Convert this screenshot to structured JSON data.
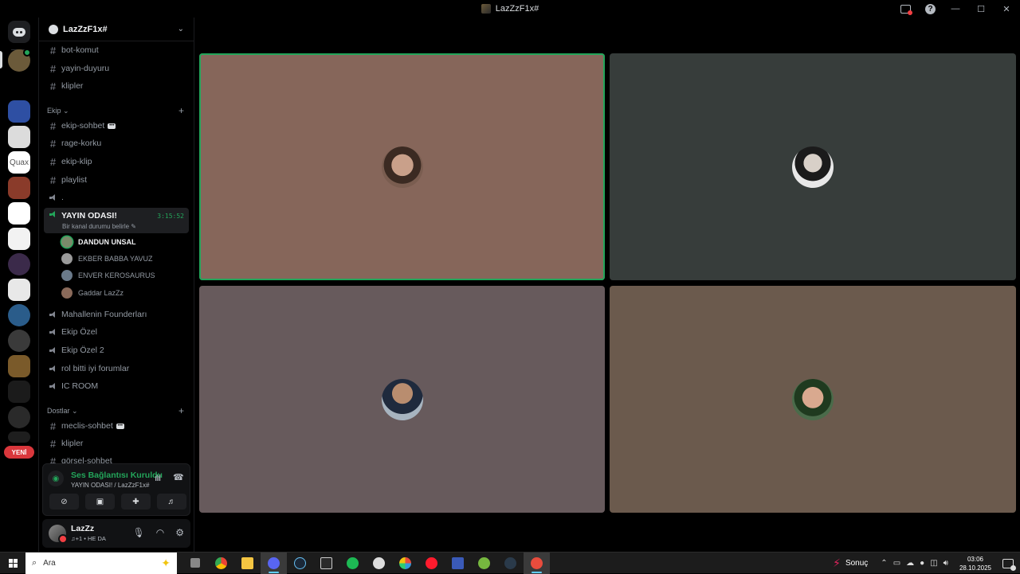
{
  "window": {
    "title": "LazZzF1x#"
  },
  "server_rail": {
    "new_badge": "YENİ",
    "servers": [
      {
        "name": "home",
        "color": "#1e1f22"
      },
      {
        "name": "server-lazzz",
        "color": "#6b5a3a"
      },
      {
        "name": "server-2",
        "color": "#2e4fa3"
      },
      {
        "name": "server-3",
        "color": "#dcdcdc"
      },
      {
        "name": "server-quax",
        "color": "#ffffff"
      },
      {
        "name": "server-5",
        "color": "#8a3b2a"
      },
      {
        "name": "server-6",
        "color": "#ffffff"
      },
      {
        "name": "server-7",
        "color": "#f2f2f2"
      },
      {
        "name": "server-8",
        "color": "#3b2a4a"
      },
      {
        "name": "server-9",
        "color": "#e8e8e8"
      },
      {
        "name": "server-10",
        "color": "#2a5c8a"
      },
      {
        "name": "server-11",
        "color": "#3a3a3a"
      },
      {
        "name": "server-12",
        "color": "#7a5a2a"
      },
      {
        "name": "server-13",
        "color": "#1b1b1b"
      },
      {
        "name": "server-14",
        "color": "#2a2a2a"
      },
      {
        "name": "server-15",
        "color": "#1e1e1e"
      }
    ]
  },
  "guild": {
    "name": "LazZzF1x#"
  },
  "channels": {
    "top": [
      "bot-komut",
      "yayin-duyuru",
      "klipler"
    ],
    "ekip_category": "Ekip",
    "ekip": [
      "ekip-sohbet",
      "rage-korku",
      "ekip-klip",
      "playlist"
    ],
    "voice_dot": ".",
    "active_voice": {
      "name": "YAYIN ODASI!",
      "status": "Bir kanal durumu belirle",
      "timer": "3:15:52"
    },
    "voice_users": [
      "DANDUN UNSAL",
      "EKBER BABBA YAVUZ",
      "ENVER KEROSAURUS",
      "Gaddar LazZz"
    ],
    "more_voice": [
      "Mahallenin Founderları",
      "Ekip Özel",
      "Ekip Özel 2",
      "rol bitti iyi forumlar",
      "IC ROOM"
    ],
    "dostlar_category": "Dostlar",
    "dostlar": [
      "meclis-sohbet",
      "klipler",
      "görsel-sohbet"
    ]
  },
  "voice_panel": {
    "title": "Ses Bağlantısı Kuruldu",
    "subtitle": "YAYIN ODASI! / LazZzF1x#"
  },
  "user_panel": {
    "name": "LazZz",
    "status": "♫+1 • HE DA"
  },
  "stage": {
    "tiles": [
      {
        "color": "#86665a",
        "speaking": true
      },
      {
        "color": "#373d3b",
        "speaking": false
      },
      {
        "color": "#675a5c",
        "speaking": false
      },
      {
        "color": "#6b5a4d",
        "speaking": false
      }
    ]
  },
  "taskbar": {
    "search_placeholder": "Ara",
    "apps": [
      {
        "name": "task-view",
        "color": "#888888"
      },
      {
        "name": "chrome",
        "color": "#4285f4"
      },
      {
        "name": "file-explorer",
        "color": "#f4c542"
      },
      {
        "name": "discord",
        "color": "#5865f2",
        "active": true
      },
      {
        "name": "steam",
        "color": "#1b2838"
      },
      {
        "name": "epic-games",
        "color": "#2a2a2a"
      },
      {
        "name": "spotify",
        "color": "#1db954"
      },
      {
        "name": "app-8",
        "color": "#dddddd"
      },
      {
        "name": "app-9",
        "color": "#e84c3d"
      },
      {
        "name": "opera",
        "color": "#ff1b2d"
      },
      {
        "name": "app-11",
        "color": "#3a5ab8"
      },
      {
        "name": "utorrent",
        "color": "#76b83f"
      },
      {
        "name": "app-13",
        "color": "#2a3a4a"
      },
      {
        "name": "app-14",
        "color": "#e84c3d",
        "active": true
      }
    ],
    "tray_label": "Sonuç",
    "time": "03:06",
    "date": "28.10.2025"
  }
}
